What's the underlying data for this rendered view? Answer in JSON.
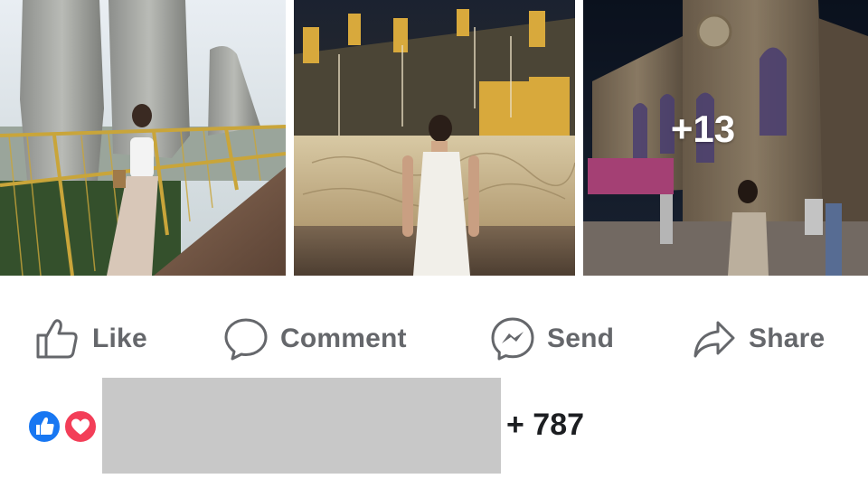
{
  "post": {
    "photos": [
      {
        "alt": "woman-on-golden-bridge-with-stone-hands"
      },
      {
        "alt": "woman-in-white-dress-at-golden-fountain"
      },
      {
        "alt": "woman-in-front-of-gothic-cathedral"
      }
    ],
    "more_count": "+13"
  },
  "actions": {
    "like_label": "Like",
    "comment_label": "Comment",
    "send_label": "Send",
    "share_label": "Share"
  },
  "reactions": {
    "count_text": "+ 787",
    "like_color": "#1877f2",
    "love_color": "#f33e58"
  }
}
